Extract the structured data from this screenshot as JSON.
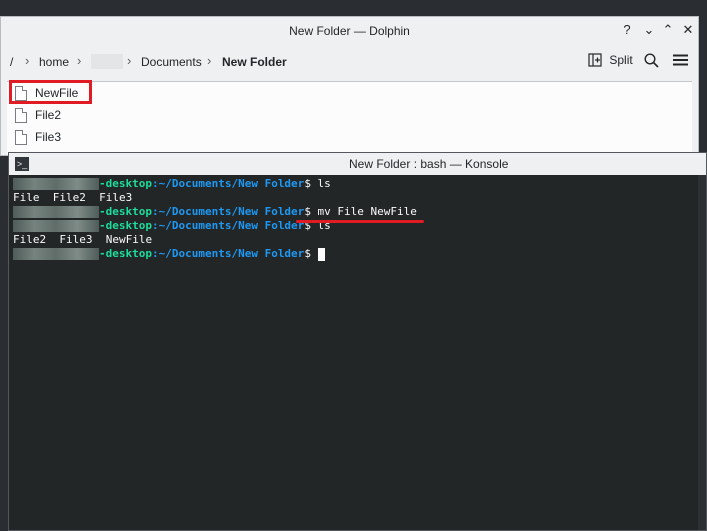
{
  "dolphin": {
    "title": "New Folder — Dolphin",
    "window_controls": [
      "?",
      "⌄",
      "⌃",
      "✕"
    ],
    "breadcrumb": {
      "root": "/",
      "home": "home",
      "documents": "Documents",
      "current": "New Folder"
    },
    "toolbar": {
      "split_label": "Split"
    },
    "files": [
      "NewFile",
      "File2",
      "File3"
    ]
  },
  "konsole": {
    "title": "New Folder : bash — Konsole",
    "host_suffix": "-desktop",
    "path": ":~/Documents/New Folder",
    "prompt_symbol": "$",
    "lines": [
      {
        "type": "prompt",
        "command": " ls"
      },
      {
        "type": "output",
        "text": "File  File2  File3"
      },
      {
        "type": "prompt",
        "command": " mv File NewFile"
      },
      {
        "type": "prompt",
        "command": " ls"
      },
      {
        "type": "output",
        "text": "File2  File3  NewFile"
      },
      {
        "type": "prompt",
        "command": " "
      }
    ]
  },
  "colors": {
    "annotation_red": "#e01b24",
    "terminal_bg": "#232627",
    "host_green": "#1cdc9a",
    "path_blue": "#1d99f3"
  }
}
